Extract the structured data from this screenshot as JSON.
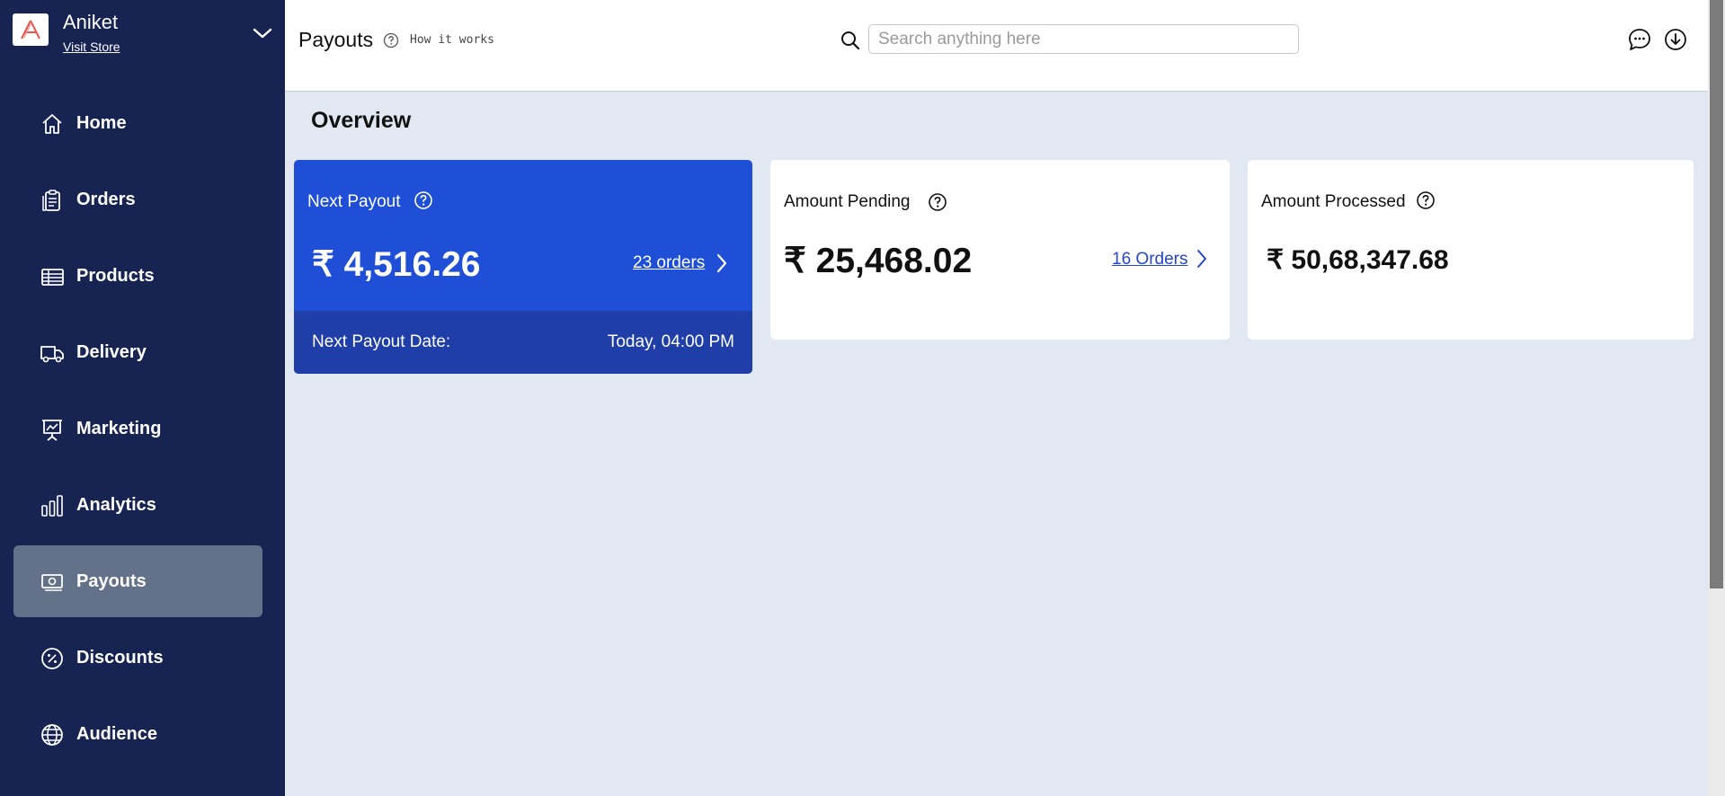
{
  "store": {
    "name": "Aniket",
    "visit_label": "Visit Store"
  },
  "nav": {
    "items": [
      {
        "label": "Home",
        "icon": "home-icon"
      },
      {
        "label": "Orders",
        "icon": "clipboard-icon"
      },
      {
        "label": "Products",
        "icon": "table-icon"
      },
      {
        "label": "Delivery",
        "icon": "truck-icon"
      },
      {
        "label": "Marketing",
        "icon": "presentation-chart-icon"
      },
      {
        "label": "Analytics",
        "icon": "bar-chart-icon"
      },
      {
        "label": "Payouts",
        "icon": "money-icon",
        "active": true
      },
      {
        "label": "Discounts",
        "icon": "percent-badge-icon"
      },
      {
        "label": "Audience",
        "icon": "globe-icon"
      }
    ]
  },
  "topbar": {
    "title": "Payouts",
    "how_it_works": "How it works",
    "search_placeholder": "Search anything here"
  },
  "main": {
    "heading": "Overview",
    "cards": {
      "next_payout": {
        "title": "Next Payout",
        "amount": "₹ 4,516.26",
        "orders_link": "23 orders",
        "date_label": "Next Payout Date:",
        "date_value": "Today, 04:00 PM"
      },
      "amount_pending": {
        "title": "Amount Pending",
        "amount": "₹ 25,468.02",
        "orders_link": "16 Orders"
      },
      "amount_processed": {
        "title": "Amount Processed",
        "amount": "₹ 50,68,347.68"
      }
    }
  },
  "colors": {
    "sidebar_bg": "#172452",
    "active_nav_bg": "#637189",
    "next_payout_card": "#1e4fd6",
    "next_payout_footer": "#1f3ea8",
    "link_blue": "#2447c9",
    "page_bg": "#e1e8f1"
  }
}
